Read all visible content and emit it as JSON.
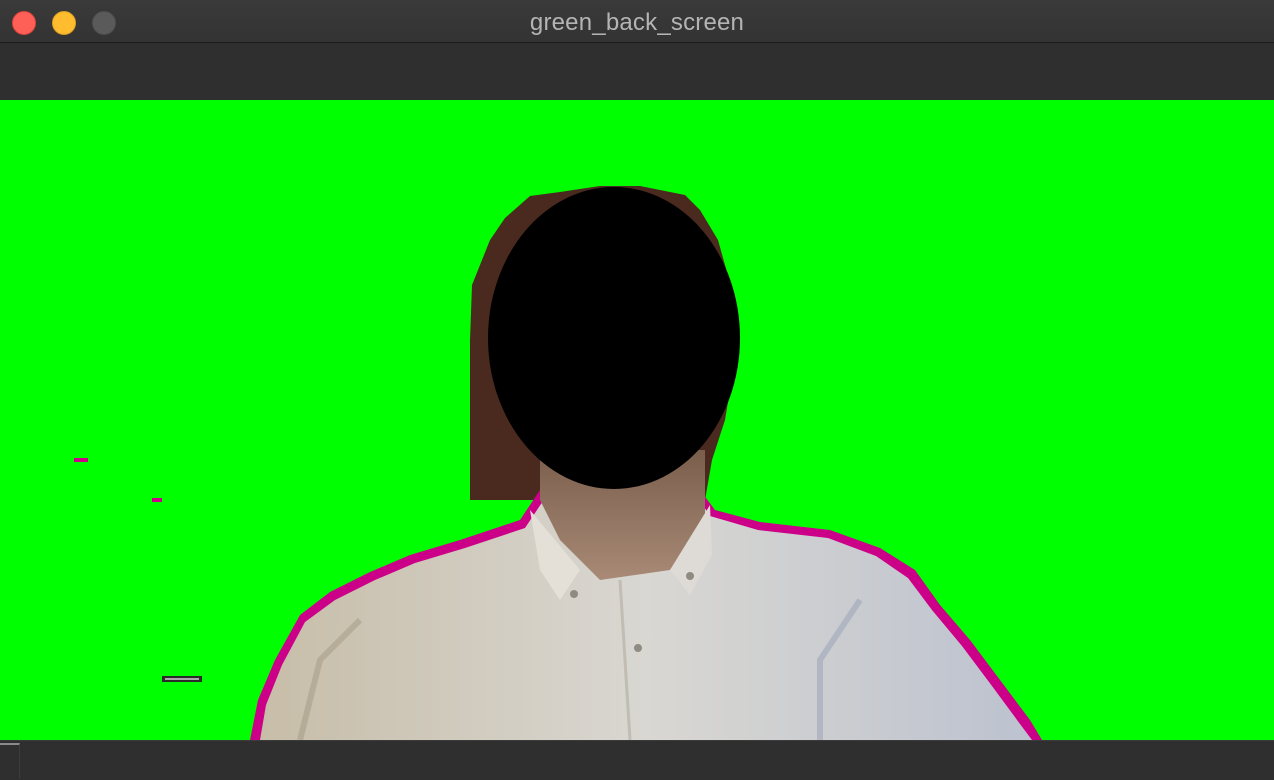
{
  "window": {
    "title": "green_back_screen"
  },
  "icons": {
    "close": "close-button-icon",
    "minimize": "minimize-button-icon",
    "zoom": "zoom-button-icon"
  },
  "colors": {
    "chroma_background": "#00ff00",
    "fringe": "#cc0088",
    "face_mask": "#000000",
    "shirt": "#cfc8bb"
  }
}
